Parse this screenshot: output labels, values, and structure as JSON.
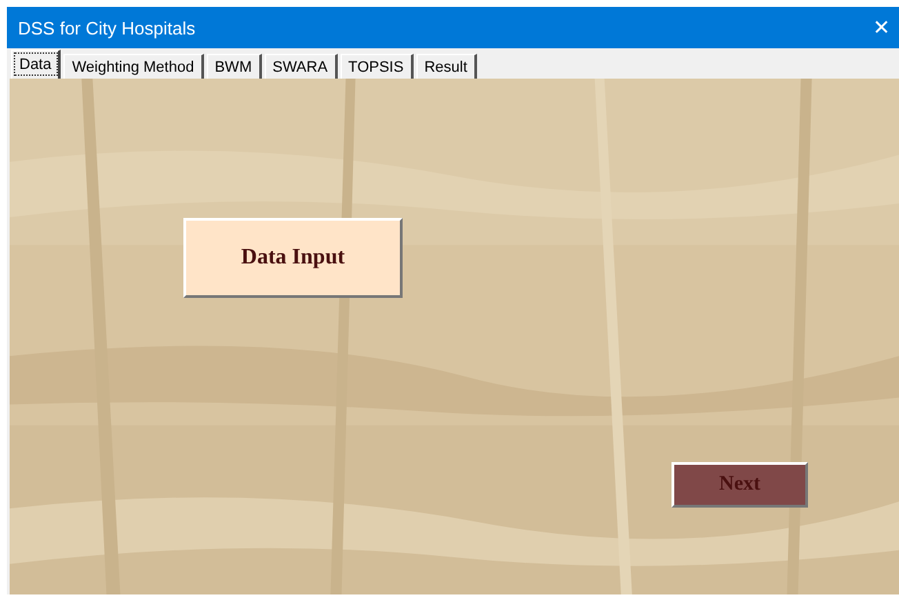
{
  "window": {
    "title": "DSS for City Hospitals",
    "close": "✕"
  },
  "tabs": [
    {
      "label": "Data",
      "selected": true
    },
    {
      "label": "Weighting Method",
      "selected": false
    },
    {
      "label": "BWM",
      "selected": false
    },
    {
      "label": "SWARA",
      "selected": false
    },
    {
      "label": "TOPSIS",
      "selected": false
    },
    {
      "label": "Result",
      "selected": false
    }
  ],
  "buttons": [
    {
      "label": "Data Input",
      "kind": "light"
    },
    {
      "label": "Next",
      "kind": "dark"
    }
  ]
}
